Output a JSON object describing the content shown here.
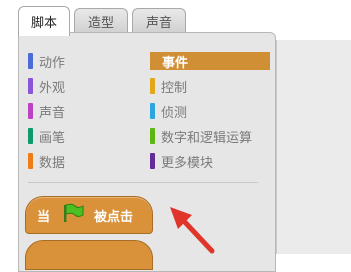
{
  "tabs": [
    {
      "label": "脚本",
      "active": true
    },
    {
      "label": "造型",
      "active": false
    },
    {
      "label": "声音",
      "active": false
    }
  ],
  "categories_left": [
    {
      "label": "动作",
      "color": "#4a6cd4"
    },
    {
      "label": "外观",
      "color": "#8a55d7"
    },
    {
      "label": "声音",
      "color": "#bb42c3"
    },
    {
      "label": "画笔",
      "color": "#0e9a6c"
    },
    {
      "label": "数据",
      "color": "#ee7d16"
    }
  ],
  "categories_right": [
    {
      "label": "事件",
      "color": "#c88330",
      "selected": true
    },
    {
      "label": "控制",
      "color": "#e1a91a",
      "selected": false
    },
    {
      "label": "侦测",
      "color": "#2ca5e2",
      "selected": false
    },
    {
      "label": "数字和逻辑运算",
      "color": "#5cb712",
      "selected": false
    },
    {
      "label": "更多模块",
      "color": "#632d99",
      "selected": false
    }
  ],
  "block": {
    "prefix": "当",
    "icon": "green-flag-icon",
    "suffix": "被点击",
    "color": "#d9923a"
  },
  "annotation": {
    "icon": "red-arrow-icon",
    "color": "#e0352b"
  }
}
